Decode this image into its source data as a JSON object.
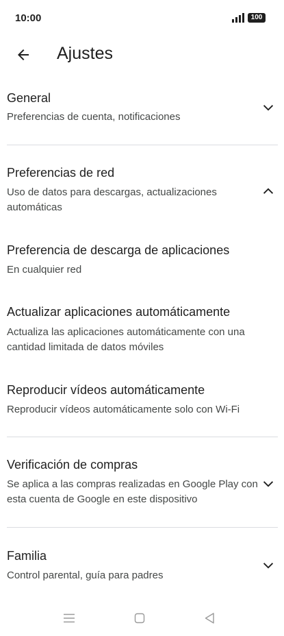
{
  "status_bar": {
    "time": "10:00",
    "battery": "100"
  },
  "header": {
    "title": "Ajustes"
  },
  "sections": {
    "general": {
      "title": "General",
      "subtitle": "Preferencias de cuenta, notificaciones"
    },
    "network": {
      "title": "Preferencias de red",
      "subtitle": "Uso de datos para descargas, actualizaciones automáticas"
    },
    "download_pref": {
      "title": "Preferencia de descarga de aplicaciones",
      "subtitle": "En cualquier red"
    },
    "auto_update": {
      "title": "Actualizar aplicaciones automáticamente",
      "subtitle": "Actualiza las aplicaciones automáticamente con una cantidad limitada de datos móviles"
    },
    "autoplay": {
      "title": "Reproducir vídeos automáticamente",
      "subtitle": "Reproducir vídeos automáticamente solo con Wi-Fi"
    },
    "purchase": {
      "title": "Verificación de compras",
      "subtitle": "Se aplica a las compras realizadas en Google Play con esta cuenta de Google en este dispositivo"
    },
    "family": {
      "title": "Familia",
      "subtitle": "Control parental, guía para padres"
    }
  },
  "icons": {
    "back": "arrow-back-icon",
    "expand": "chevron-down-icon",
    "collapse": "chevron-up-icon",
    "nav_menu": "menu-icon",
    "nav_home": "square-home-icon",
    "nav_back": "triangle-back-icon"
  }
}
